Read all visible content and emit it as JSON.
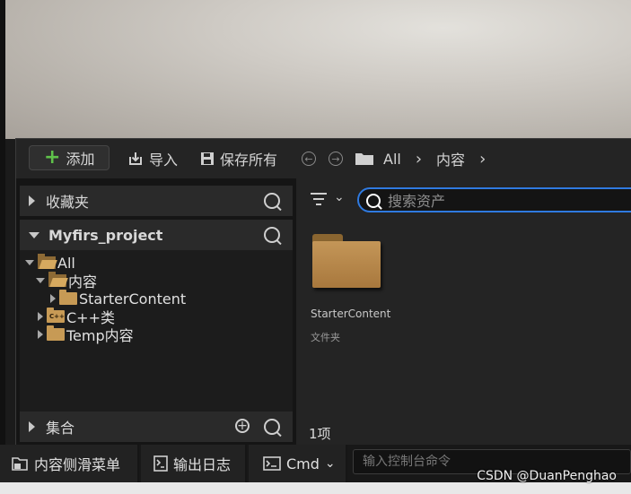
{
  "toolbar": {
    "add_label": "添加",
    "import_label": "导入",
    "save_all_label": "保存所有",
    "breadcrumb": [
      "All",
      "内容"
    ]
  },
  "sidebar": {
    "favorites_label": "收藏夹",
    "project_label": "Myfirs_project",
    "tree": [
      {
        "label": "All"
      },
      {
        "label": "内容"
      },
      {
        "label": "StarterContent"
      },
      {
        "label": "C++类"
      },
      {
        "label": "Temp内容"
      }
    ],
    "collections_label": "集合"
  },
  "content": {
    "search_placeholder": "搜索资产",
    "items": [
      {
        "name": "StarterContent",
        "type": "文件夹"
      }
    ],
    "count": "1项"
  },
  "statusbar": {
    "drawer_label": "内容侧滑菜单",
    "output_log_label": "输出日志",
    "cmd_label": "Cmd",
    "console_placeholder": "输入控制台命令"
  },
  "watermark": "CSDN @DuanPenghao",
  "colors": {
    "accent": "#2f7ae0",
    "add_green": "#5fc24a",
    "folder": "#c79a55"
  }
}
